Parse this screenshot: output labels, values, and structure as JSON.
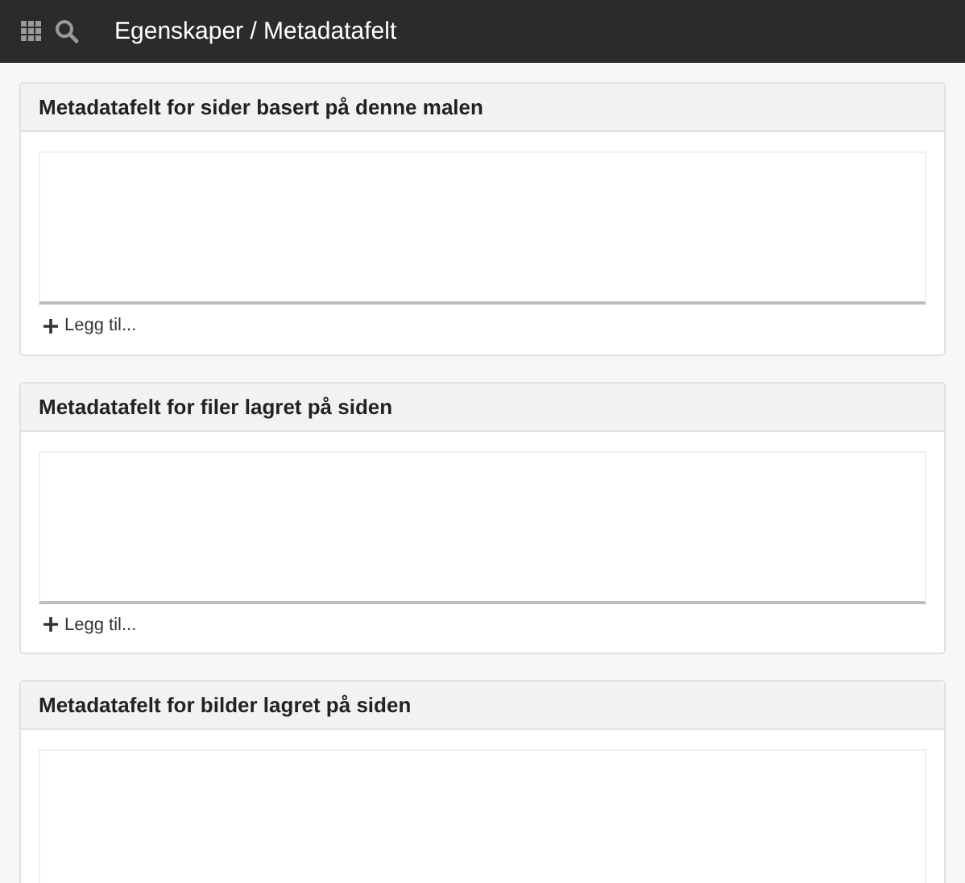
{
  "topbar": {
    "title": "Egenskaper / Metadatafelt"
  },
  "panels": [
    {
      "title": "Metadatafelt for sider basert på denne malen",
      "add_label": "Legg til..."
    },
    {
      "title": "Metadatafelt for filer lagret på siden",
      "add_label": "Legg til..."
    },
    {
      "title": "Metadatafelt for bilder lagret på siden"
    }
  ]
}
